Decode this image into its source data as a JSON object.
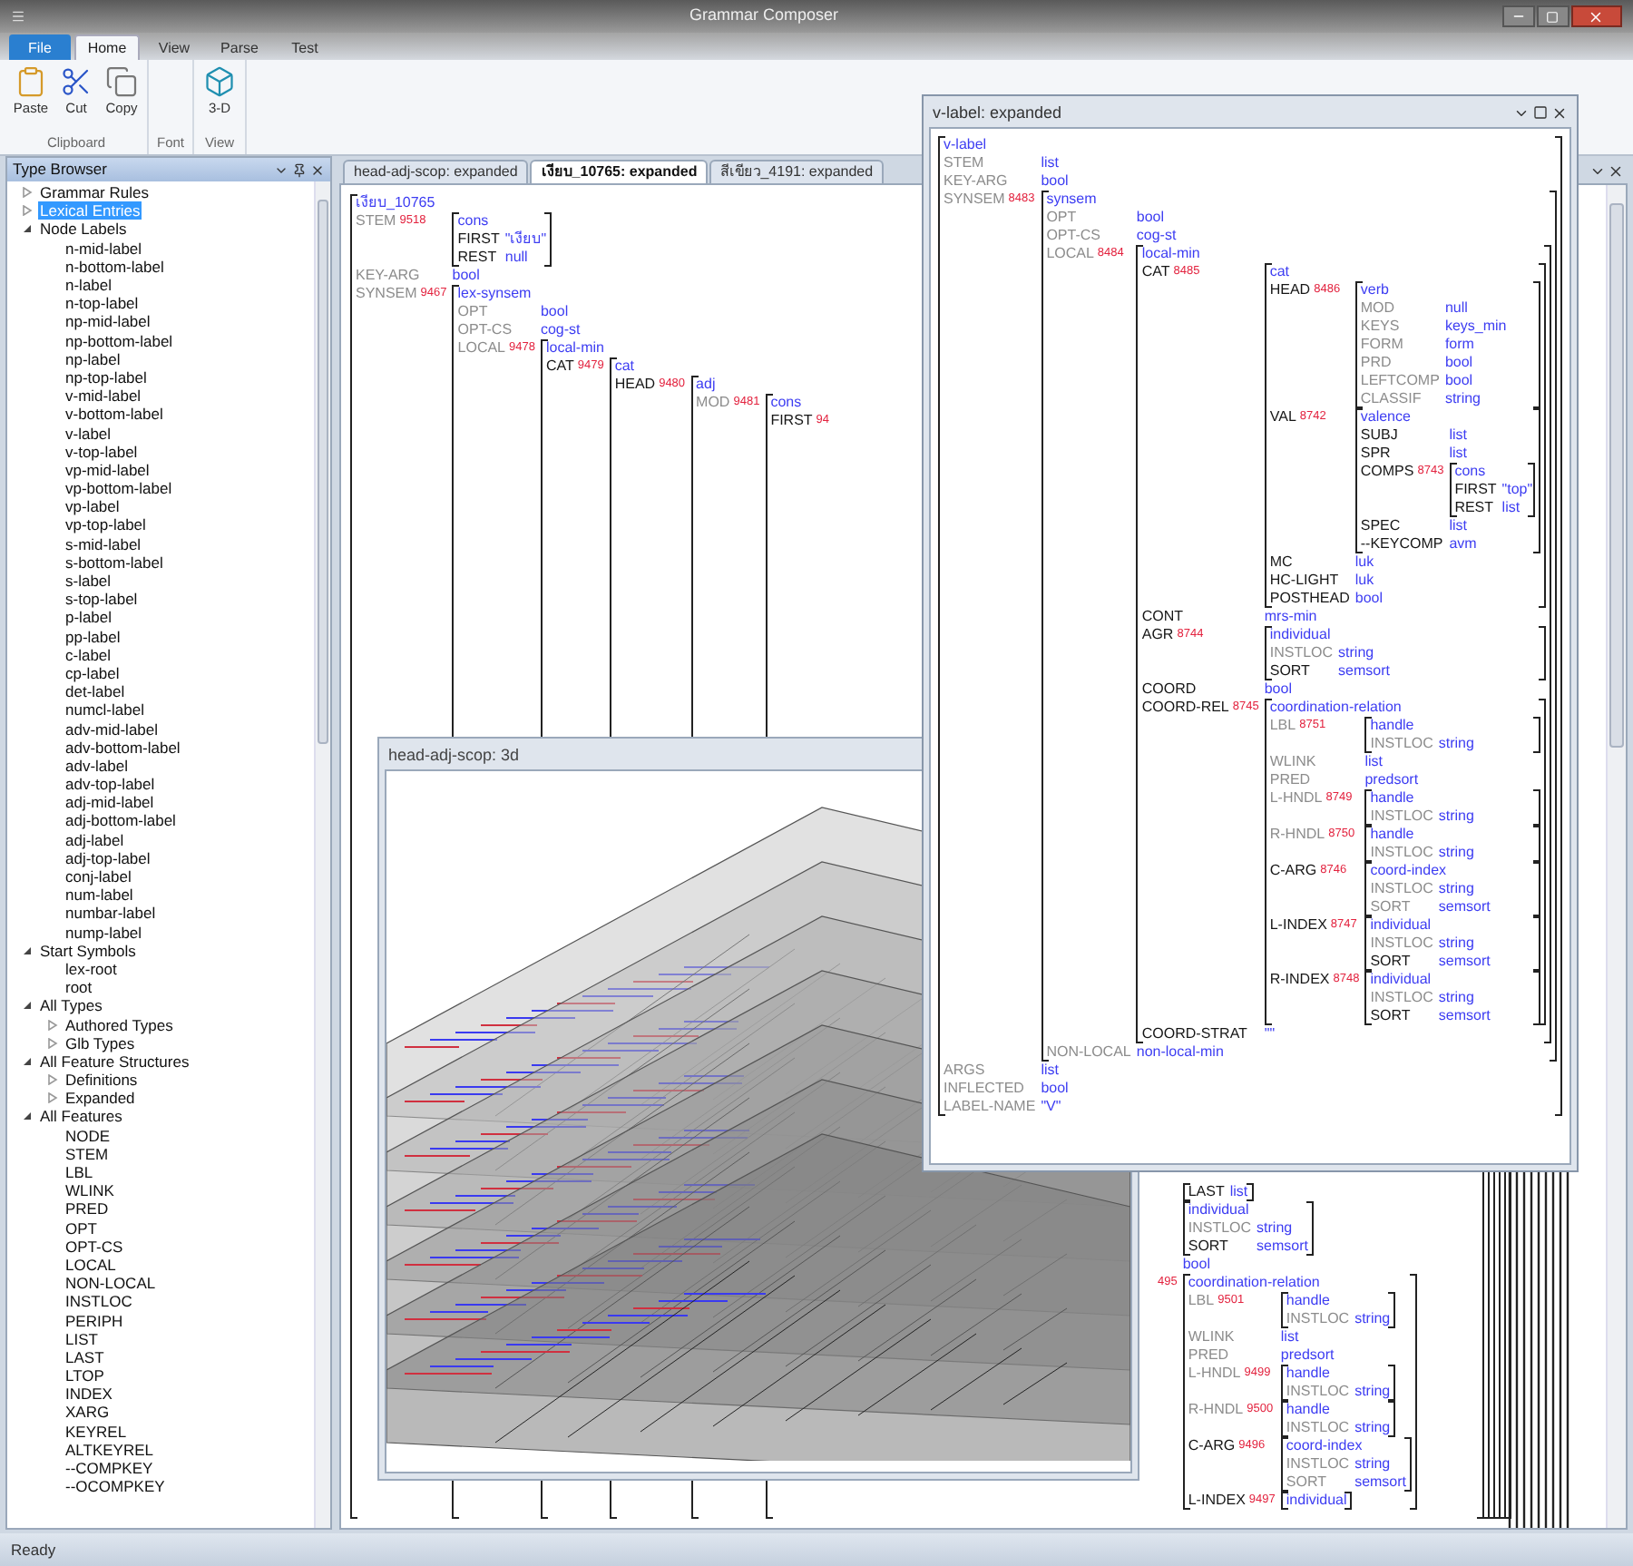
{
  "window": {
    "title": "Grammar Composer"
  },
  "ribbon": {
    "tabs": [
      {
        "label": "File",
        "kind": "application",
        "selected": false
      },
      {
        "label": "Home",
        "kind": "tab",
        "selected": true
      },
      {
        "label": "View",
        "kind": "tab",
        "selected": false
      },
      {
        "label": "Parse",
        "kind": "tab",
        "selected": false
      },
      {
        "label": "Test",
        "kind": "tab",
        "selected": false
      }
    ],
    "groups": [
      {
        "label": "Clipboard",
        "buttons": [
          {
            "label": "Paste"
          },
          {
            "label": "Cut"
          },
          {
            "label": "Copy"
          }
        ]
      },
      {
        "label": "Font"
      },
      {
        "label": "View",
        "buttons": [
          {
            "label": "3-D"
          }
        ]
      }
    ]
  },
  "type_browser": {
    "title": "Type Browser",
    "items": [
      {
        "label": "Grammar Rules",
        "expanded": false,
        "selected": false
      },
      {
        "label": "Lexical Entries",
        "expanded": false,
        "selected": true
      },
      {
        "label": "Node Labels",
        "expanded": true,
        "selected": false,
        "children": [
          {
            "label": "n-mid-label",
            "selected": false
          },
          {
            "label": "n-bottom-label",
            "selected": false
          },
          {
            "label": "n-label",
            "selected": false
          },
          {
            "label": "n-top-label",
            "selected": false
          },
          {
            "label": "np-mid-label",
            "selected": false
          },
          {
            "label": "np-bottom-label",
            "selected": false
          },
          {
            "label": "np-label",
            "selected": false
          },
          {
            "label": "np-top-label",
            "selected": false
          },
          {
            "label": "v-mid-label",
            "selected": false
          },
          {
            "label": "v-bottom-label",
            "selected": false
          },
          {
            "label": "v-label",
            "selected": false
          },
          {
            "label": "v-top-label",
            "selected": false
          },
          {
            "label": "vp-mid-label",
            "selected": false
          },
          {
            "label": "vp-bottom-label",
            "selected": false
          },
          {
            "label": "vp-label",
            "selected": false
          },
          {
            "label": "vp-top-label",
            "selected": false
          },
          {
            "label": "s-mid-label",
            "selected": false
          },
          {
            "label": "s-bottom-label",
            "selected": false
          },
          {
            "label": "s-label",
            "selected": false
          },
          {
            "label": "s-top-label",
            "selected": false
          },
          {
            "label": "p-label",
            "selected": false
          },
          {
            "label": "pp-label",
            "selected": false
          },
          {
            "label": "c-label",
            "selected": false
          },
          {
            "label": "cp-label",
            "selected": false
          },
          {
            "label": "det-label",
            "selected": false
          },
          {
            "label": "numcl-label",
            "selected": false
          },
          {
            "label": "adv-mid-label",
            "selected": false
          },
          {
            "label": "adv-bottom-label",
            "selected": false
          },
          {
            "label": "adv-label",
            "selected": false
          },
          {
            "label": "adv-top-label",
            "selected": false
          },
          {
            "label": "adj-mid-label",
            "selected": false
          },
          {
            "label": "adj-bottom-label",
            "selected": false
          },
          {
            "label": "adj-label",
            "selected": false
          },
          {
            "label": "adj-top-label",
            "selected": false
          },
          {
            "label": "conj-label",
            "selected": false
          },
          {
            "label": "num-label",
            "selected": false
          },
          {
            "label": "numbar-label",
            "selected": false
          },
          {
            "label": "nump-label",
            "selected": false
          }
        ]
      },
      {
        "label": "Start Symbols",
        "expanded": true,
        "selected": false,
        "children": [
          {
            "label": "lex-root",
            "selected": false
          },
          {
            "label": "root",
            "selected": false
          }
        ]
      },
      {
        "label": "All Types",
        "expanded": true,
        "selected": false,
        "children": [
          {
            "label": "Authored Types",
            "expanded": false,
            "selected": false
          },
          {
            "label": "Glb Types",
            "expanded": false,
            "selected": false
          }
        ]
      },
      {
        "label": "All Feature Structures",
        "expanded": true,
        "selected": false,
        "children": [
          {
            "label": "Definitions",
            "expanded": false,
            "selected": false
          },
          {
            "label": "Expanded",
            "expanded": false,
            "selected": false
          }
        ]
      },
      {
        "label": "All Features",
        "expanded": true,
        "selected": false,
        "children": [
          {
            "label": "NODE",
            "selected": false
          },
          {
            "label": "STEM",
            "selected": false
          },
          {
            "label": "LBL",
            "selected": false
          },
          {
            "label": "WLINK",
            "selected": false
          },
          {
            "label": "PRED",
            "selected": false
          },
          {
            "label": "OPT",
            "selected": false
          },
          {
            "label": "OPT-CS",
            "selected": false
          },
          {
            "label": "LOCAL",
            "selected": false
          },
          {
            "label": "NON-LOCAL",
            "selected": false
          },
          {
            "label": "INSTLOC",
            "selected": false
          },
          {
            "label": "PERIPH",
            "selected": false
          },
          {
            "label": "LIST",
            "selected": false
          },
          {
            "label": "LAST",
            "selected": false
          },
          {
            "label": "LTOP",
            "selected": false
          },
          {
            "label": "INDEX",
            "selected": false
          },
          {
            "label": "XARG",
            "selected": false
          },
          {
            "label": "KEYREL",
            "selected": false
          },
          {
            "label": "ALTKEYREL",
            "selected": false
          },
          {
            "label": "--COMPKEY",
            "selected": false
          },
          {
            "label": "--OCOMPKEY",
            "selected": false
          }
        ]
      }
    ]
  },
  "documents": {
    "tabs": [
      {
        "label": "head-adj-scop: expanded",
        "selected": false
      },
      {
        "label": "เงียบ_10765: expanded",
        "selected": true
      },
      {
        "label": "สีเขียว_4191: expanded",
        "selected": false
      }
    ],
    "feature_structure": {
      "type": "เงียบ_10765",
      "features": [
        {
          "name": "STEM",
          "dim": true,
          "tag": "9518",
          "kind": "avm",
          "value": {
            "type": "cons",
            "features": [
              {
                "name": "FIRST",
                "dim": false,
                "kind": "atom",
                "value": "\"เงียบ\""
              },
              {
                "name": "REST",
                "dim": false,
                "kind": "atom",
                "value": "null"
              }
            ]
          }
        },
        {
          "name": "KEY-ARG",
          "dim": true,
          "kind": "atom",
          "value": "bool"
        },
        {
          "name": "SYNSEM",
          "dim": true,
          "tag": "9467",
          "kind": "avm",
          "value": {
            "type": "lex-synsem",
            "features": [
              {
                "name": "OPT",
                "dim": true,
                "kind": "atom",
                "value": "bool"
              },
              {
                "name": "OPT-CS",
                "dim": true,
                "kind": "atom",
                "value": "cog-st"
              },
              {
                "name": "LOCAL",
                "dim": true,
                "tag": "9478",
                "kind": "avm",
                "value": {
                  "type": "local-min",
                  "features": [
                    {
                      "name": "CAT",
                      "dim": false,
                      "tag": "9479",
                      "kind": "avm",
                      "value": {
                        "type": "cat",
                        "features": [
                          {
                            "name": "HEAD",
                            "dim": false,
                            "tag": "9480",
                            "kind": "avm",
                            "value": {
                              "type": "adj",
                              "features": [
                                {
                                  "name": "MOD",
                                  "dim": true,
                                  "tag": "9481",
                                  "kind": "avm",
                                  "value": {
                                    "type": "cons",
                                    "features": [
                                      {
                                        "name": "FIRST",
                                        "dim": false,
                                        "tag": "94"
                                      }
                                    ]
                                  }
                                }
                              ]
                            }
                          }
                        ]
                      }
                    }
                  ]
                }
              }
            ]
          }
        }
      ]
    },
    "fragment": {
      "features": [
        {
          "kind": "avm",
          "value": {
            "features": [
              {
                "name": "LAST",
                "dim": false,
                "kind": "atom",
                "value": "list"
              }
            ]
          }
        },
        {
          "kind": "avm",
          "value": {
            "type": "individual",
            "features": [
              {
                "name": "INSTLOC",
                "dim": true,
                "kind": "atom",
                "value": "string"
              },
              {
                "name": "SORT",
                "dim": false,
                "kind": "atom",
                "value": "semsort"
              }
            ]
          }
        },
        {
          "kind": "atom",
          "value": "bool"
        },
        {
          "tag": "495",
          "kind": "avm",
          "value": {
            "type": "coordination-relation",
            "features": [
              {
                "name": "LBL",
                "dim": true,
                "tag": "9501",
                "kind": "avm",
                "value": {
                  "type": "handle",
                  "features": [
                    {
                      "name": "INSTLOC",
                      "dim": true,
                      "kind": "atom",
                      "value": "string"
                    }
                  ]
                }
              },
              {
                "name": "WLINK",
                "dim": true,
                "kind": "atom",
                "value": "list"
              },
              {
                "name": "PRED",
                "dim": true,
                "kind": "atom",
                "value": "predsort"
              },
              {
                "name": "L-HNDL",
                "dim": true,
                "tag": "9499",
                "kind": "avm",
                "value": {
                  "type": "handle",
                  "features": [
                    {
                      "name": "INSTLOC",
                      "dim": true,
                      "kind": "atom",
                      "value": "string"
                    }
                  ]
                }
              },
              {
                "name": "R-HNDL",
                "dim": true,
                "tag": "9500",
                "kind": "avm",
                "value": {
                  "type": "handle",
                  "features": [
                    {
                      "name": "INSTLOC",
                      "dim": true,
                      "kind": "atom",
                      "value": "string"
                    }
                  ]
                }
              },
              {
                "name": "C-ARG",
                "dim": false,
                "tag": "9496",
                "kind": "avm",
                "value": {
                  "type": "coord-index",
                  "features": [
                    {
                      "name": "INSTLOC",
                      "dim": true,
                      "kind": "atom",
                      "value": "string"
                    },
                    {
                      "name": "SORT",
                      "dim": true,
                      "kind": "atom",
                      "value": "semsort"
                    }
                  ]
                }
              },
              {
                "name": "L-INDEX",
                "dim": false,
                "tag": "9497",
                "kind": "avm",
                "value": {
                  "type": "individual"
                }
              }
            ]
          }
        }
      ]
    }
  },
  "windows": [
    {
      "title": "head-adj-scop: 3d",
      "kind": "view3d"
    },
    {
      "title": "v-label: expanded",
      "kind": "avm",
      "feature_structure": {
        "type": "v-label",
        "features": [
          {
            "name": "STEM",
            "dim": true,
            "kind": "atom",
            "value": "list"
          },
          {
            "name": "KEY-ARG",
            "dim": true,
            "kind": "atom",
            "value": "bool"
          },
          {
            "name": "SYNSEM",
            "dim": true,
            "tag": "8483",
            "kind": "avm",
            "value": {
              "type": "synsem",
              "features": [
                {
                  "name": "OPT",
                  "dim": true,
                  "kind": "atom",
                  "value": "bool"
                },
                {
                  "name": "OPT-CS",
                  "dim": true,
                  "kind": "atom",
                  "value": "cog-st"
                },
                {
                  "name": "LOCAL",
                  "dim": true,
                  "tag": "8484",
                  "kind": "avm",
                  "value": {
                    "type": "local-min",
                    "features": [
                      {
                        "name": "CAT",
                        "dim": false,
                        "tag": "8485",
                        "kind": "avm",
                        "value": {
                          "type": "cat",
                          "features": [
                            {
                              "name": "HEAD",
                              "dim": false,
                              "tag": "8486",
                              "kind": "avm",
                              "value": {
                                "type": "verb",
                                "features": [
                                  {
                                    "name": "MOD",
                                    "dim": true,
                                    "kind": "atom",
                                    "value": "null"
                                  },
                                  {
                                    "name": "KEYS",
                                    "dim": true,
                                    "kind": "atom",
                                    "value": "keys_min"
                                  },
                                  {
                                    "name": "FORM",
                                    "dim": true,
                                    "kind": "atom",
                                    "value": "form"
                                  },
                                  {
                                    "name": "PRD",
                                    "dim": true,
                                    "kind": "atom",
                                    "value": "bool"
                                  },
                                  {
                                    "name": "LEFTCOMP",
                                    "dim": true,
                                    "kind": "atom",
                                    "value": "bool"
                                  },
                                  {
                                    "name": "CLASSIF",
                                    "dim": true,
                                    "kind": "atom",
                                    "value": "string"
                                  }
                                ]
                              }
                            },
                            {
                              "name": "VAL",
                              "dim": false,
                              "tag": "8742",
                              "kind": "avm",
                              "value": {
                                "type": "valence",
                                "features": [
                                  {
                                    "name": "SUBJ",
                                    "dim": false,
                                    "kind": "atom",
                                    "value": "list"
                                  },
                                  {
                                    "name": "SPR",
                                    "dim": false,
                                    "kind": "atom",
                                    "value": "list"
                                  },
                                  {
                                    "name": "COMPS",
                                    "dim": false,
                                    "tag": "8743",
                                    "kind": "avm",
                                    "value": {
                                      "type": "cons",
                                      "features": [
                                        {
                                          "name": "FIRST",
                                          "dim": false,
                                          "kind": "atom",
                                          "value": "\"top\""
                                        },
                                        {
                                          "name": "REST",
                                          "dim": false,
                                          "kind": "atom",
                                          "value": "list"
                                        }
                                      ]
                                    }
                                  },
                                  {
                                    "name": "SPEC",
                                    "dim": false,
                                    "kind": "atom",
                                    "value": "list"
                                  },
                                  {
                                    "name": "--KEYCOMP",
                                    "dim": false,
                                    "kind": "atom",
                                    "value": "avm"
                                  }
                                ]
                              }
                            },
                            {
                              "name": "MC",
                              "dim": false,
                              "kind": "atom",
                              "value": "luk"
                            },
                            {
                              "name": "HC-LIGHT",
                              "dim": false,
                              "kind": "atom",
                              "value": "luk"
                            },
                            {
                              "name": "POSTHEAD",
                              "dim": false,
                              "kind": "atom",
                              "value": "bool"
                            }
                          ]
                        }
                      },
                      {
                        "name": "CONT",
                        "dim": false,
                        "kind": "atom",
                        "value": "mrs-min"
                      },
                      {
                        "name": "AGR",
                        "dim": false,
                        "tag": "8744",
                        "kind": "avm",
                        "value": {
                          "type": "individual",
                          "features": [
                            {
                              "name": "INSTLOC",
                              "dim": true,
                              "kind": "atom",
                              "value": "string"
                            },
                            {
                              "name": "SORT",
                              "dim": false,
                              "kind": "atom",
                              "value": "semsort"
                            }
                          ]
                        }
                      },
                      {
                        "name": "COORD",
                        "dim": false,
                        "kind": "atom",
                        "value": "bool"
                      },
                      {
                        "name": "COORD-REL",
                        "dim": false,
                        "tag": "8745",
                        "kind": "avm",
                        "value": {
                          "type": "coordination-relation",
                          "features": [
                            {
                              "name": "LBL",
                              "dim": true,
                              "tag": "8751",
                              "kind": "avm",
                              "value": {
                                "type": "handle",
                                "features": [
                                  {
                                    "name": "INSTLOC",
                                    "dim": true,
                                    "kind": "atom",
                                    "value": "string"
                                  }
                                ]
                              }
                            },
                            {
                              "name": "WLINK",
                              "dim": true,
                              "kind": "atom",
                              "value": "list"
                            },
                            {
                              "name": "PRED",
                              "dim": true,
                              "kind": "atom",
                              "value": "predsort"
                            },
                            {
                              "name": "L-HNDL",
                              "dim": true,
                              "tag": "8749",
                              "kind": "avm",
                              "value": {
                                "type": "handle",
                                "features": [
                                  {
                                    "name": "INSTLOC",
                                    "dim": true,
                                    "kind": "atom",
                                    "value": "string"
                                  }
                                ]
                              }
                            },
                            {
                              "name": "R-HNDL",
                              "dim": true,
                              "tag": "8750",
                              "kind": "avm",
                              "value": {
                                "type": "handle",
                                "features": [
                                  {
                                    "name": "INSTLOC",
                                    "dim": true,
                                    "kind": "atom",
                                    "value": "string"
                                  }
                                ]
                              }
                            },
                            {
                              "name": "C-ARG",
                              "dim": false,
                              "tag": "8746",
                              "kind": "avm",
                              "value": {
                                "type": "coord-index",
                                "features": [
                                  {
                                    "name": "INSTLOC",
                                    "dim": true,
                                    "kind": "atom",
                                    "value": "string"
                                  },
                                  {
                                    "name": "SORT",
                                    "dim": true,
                                    "kind": "atom",
                                    "value": "semsort"
                                  }
                                ]
                              }
                            },
                            {
                              "name": "L-INDEX",
                              "dim": false,
                              "tag": "8747",
                              "kind": "avm",
                              "value": {
                                "type": "individual",
                                "features": [
                                  {
                                    "name": "INSTLOC",
                                    "dim": true,
                                    "kind": "atom",
                                    "value": "string"
                                  },
                                  {
                                    "name": "SORT",
                                    "dim": false,
                                    "kind": "atom",
                                    "value": "semsort"
                                  }
                                ]
                              }
                            },
                            {
                              "name": "R-INDEX",
                              "dim": false,
                              "tag": "8748",
                              "kind": "avm",
                              "value": {
                                "type": "individual",
                                "features": [
                                  {
                                    "name": "INSTLOC",
                                    "dim": true,
                                    "kind": "atom",
                                    "value": "string"
                                  },
                                  {
                                    "name": "SORT",
                                    "dim": false,
                                    "kind": "atom",
                                    "value": "semsort"
                                  }
                                ]
                              }
                            }
                          ]
                        }
                      },
                      {
                        "name": "COORD-STRAT",
                        "dim": false,
                        "kind": "atom",
                        "value": "\"\""
                      }
                    ]
                  }
                },
                {
                  "name": "NON-LOCAL",
                  "dim": true,
                  "kind": "atom",
                  "value": "non-local-min"
                }
              ]
            }
          },
          {
            "name": "ARGS",
            "dim": true,
            "kind": "atom",
            "value": "list"
          },
          {
            "name": "INFLECTED",
            "dim": true,
            "kind": "atom",
            "value": "bool"
          },
          {
            "name": "LABEL-NAME",
            "dim": true,
            "kind": "atom",
            "value": "\"V\""
          }
        ]
      }
    }
  ],
  "status_bar": {
    "text": "Ready"
  }
}
